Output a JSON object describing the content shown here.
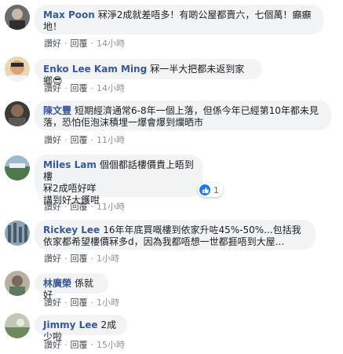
{
  "actions": {
    "like": "讚好",
    "reply": "回覆",
    "separator": "·"
  },
  "comments": [
    {
      "author": "Max Poon",
      "text": "冧淨2成就差唔多！有啲公屋都賣六，七個萬！癲癲地！",
      "time": "14小時"
    },
    {
      "author": "Enko Lee Kam Ming",
      "text": "冧一半大把都未返到家鄉😎",
      "time": "14小時"
    },
    {
      "author": "陳文豐",
      "text": "短期經濟通常6-8年一個上落，但係今年已經第10年都未見落，恐怕佢泡沫積埋一爆會爆到爛晒市",
      "time": "11小時"
    },
    {
      "author": "Miles Lam",
      "text": "個個都話樓價貴上晤到樓\n冧2成唔好咩\n講到好大鑊咁",
      "time": "11小時",
      "reaction_count": "1"
    },
    {
      "author": "Rickey Lee",
      "text": "16年年底買嘅樓到依家升咗45%-50%...包括我依家都希望樓價冧多d，因為我都唔想一世都捱唔到大屋...",
      "time": "1小時"
    },
    {
      "author": "林廣榮",
      "text": "係就好",
      "time": "1小時"
    },
    {
      "author": "Jimmy Lee",
      "text": "2成少啦",
      "time": "15小時"
    }
  ]
}
